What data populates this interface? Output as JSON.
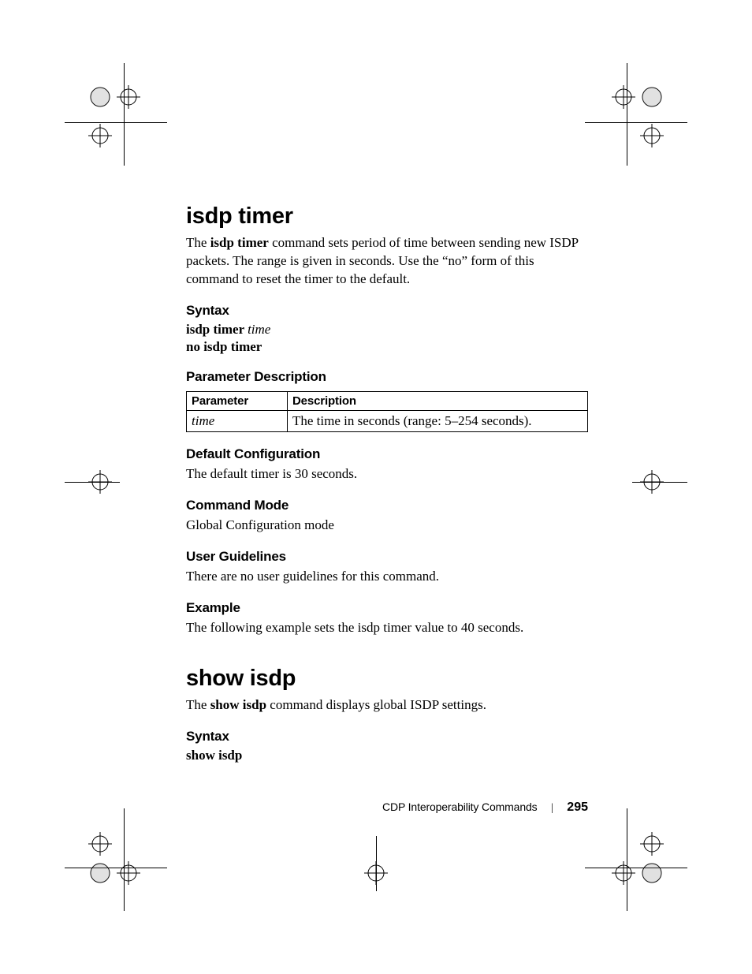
{
  "section1": {
    "title": "isdp timer",
    "intro_pre": "The ",
    "intro_bold": "isdp timer",
    "intro_post": " command sets period of time between sending new ISDP packets. The range is given in seconds. Use the “no” form of this command to reset the timer to the default.",
    "syntax_heading": "Syntax",
    "syntax_line1_bold": "isdp timer ",
    "syntax_line1_ital": "time",
    "syntax_line2_bold": "no isdp timer",
    "param_desc_heading": "Parameter Description",
    "table": {
      "h1": "Parameter",
      "h2": "Description",
      "r1c1": "time",
      "r1c2": "The time in seconds (range: 5–254 seconds)."
    },
    "default_cfg_heading": "Default Configuration",
    "default_cfg_text": "The default timer is 30 seconds.",
    "cmd_mode_heading": "Command Mode",
    "cmd_mode_text": "Global Configuration mode",
    "user_guidelines_heading": "User Guidelines",
    "user_guidelines_text": "There are no user guidelines for this command.",
    "example_heading": "Example",
    "example_text": "The following example sets the isdp timer value to 40 seconds."
  },
  "section2": {
    "title": "show isdp",
    "intro_pre": "The ",
    "intro_bold": "show isdp",
    "intro_post": " command displays global ISDP settings.",
    "syntax_heading": "Syntax",
    "syntax_line1_bold": "show isdp"
  },
  "footer": {
    "section_name": "CDP Interoperability Commands",
    "page_number": "295"
  }
}
